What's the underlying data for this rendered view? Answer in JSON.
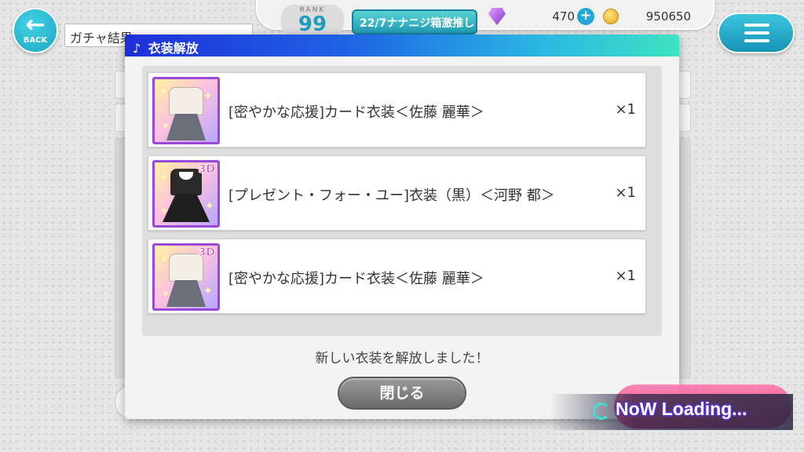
{
  "header": {
    "back_label": "BACK",
    "screen_title": "ガチャ結果",
    "rank_label": "RANK",
    "rank_value": "99",
    "event_banner": "22/7ナナニジ箱激推し",
    "gem_count": "470",
    "coin_count": "950650"
  },
  "modal": {
    "title": "衣装解放",
    "title_icon": "♪",
    "items": [
      {
        "name": "[密やかな応援]カード衣装＜佐藤 麗華＞",
        "qty": "×1",
        "badge": "",
        "outfit": "white"
      },
      {
        "name": "[プレゼント・フォー・ユー]衣装（黒）＜河野 都＞",
        "qty": "×1",
        "badge": "3D",
        "outfit": "black"
      },
      {
        "name": "[密やかな応援]カード衣装＜佐藤 麗華＞",
        "qty": "×1",
        "badge": "3D",
        "outfit": "white"
      }
    ],
    "message": "新しい衣装を解放しました！",
    "close_label": "閉じる"
  },
  "loading": {
    "text": "NoW Loading..."
  },
  "colors": {
    "accent": "#1aa6c2",
    "frame_purple": "#9b48d8",
    "header_gradient_start": "#1e2fd8",
    "header_gradient_end": "#3fe2c3"
  },
  "icons": [
    "back-arrow-icon",
    "gem-icon",
    "plus-icon",
    "coin-icon",
    "menu-icon",
    "music-note-icon",
    "loading-spinner-icon"
  ]
}
